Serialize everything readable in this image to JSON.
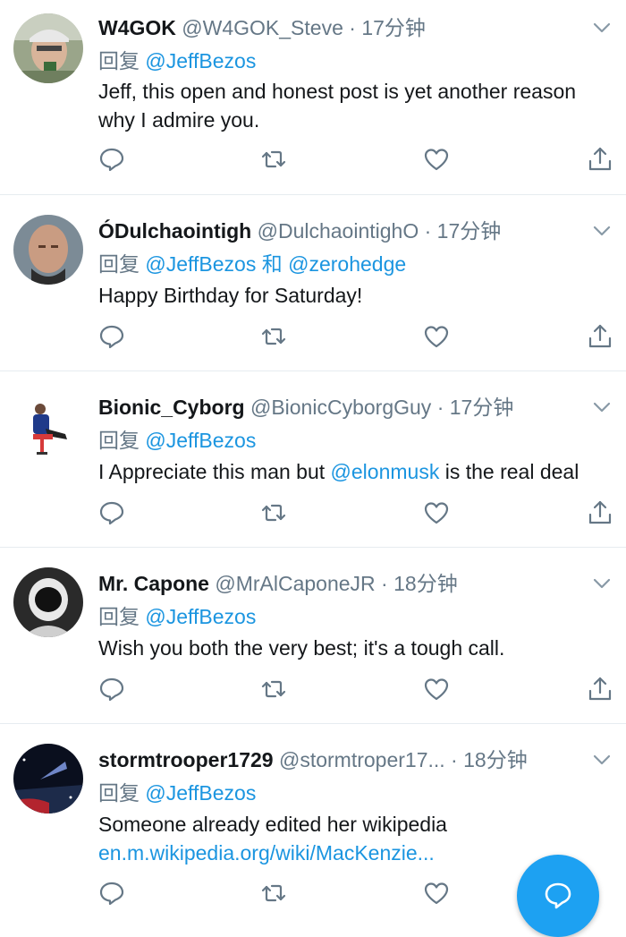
{
  "tweets": [
    {
      "name": "W4GOK",
      "handle": "@W4GOK_Steve",
      "separator": "·",
      "time": "17分钟",
      "reply_prefix": "回复",
      "reply_to": [
        "@JeffBezos"
      ],
      "reply_joiner": "",
      "text_plain": "Jeff, this open and honest post is yet another reason why I admire you.",
      "avatar_icon": "avatar-man-cap"
    },
    {
      "name": "ÓDulchaointigh",
      "handle": "@DulchaointighO",
      "separator": "·",
      "time": "17分钟",
      "reply_prefix": "回复",
      "reply_to": [
        "@JeffBezos",
        "@zerohedge"
      ],
      "reply_joiner": "和",
      "text_plain": "Happy Birthday for Saturday!",
      "avatar_icon": "avatar-bald-man"
    },
    {
      "name": "Bionic_Cyborg",
      "handle": "@BionicCyborgGuy",
      "separator": "·",
      "time": "17分钟",
      "reply_prefix": "回复",
      "reply_to": [
        "@JeffBezos"
      ],
      "reply_joiner": "",
      "text_before": "I Appreciate this man but ",
      "text_mention": "@elonmusk",
      "text_after": " is the real deal",
      "avatar_icon": "avatar-seated-figure"
    },
    {
      "name": "Mr. Capone",
      "handle": "@MrAlCaponeJR",
      "separator": "·",
      "time": "18分钟",
      "reply_prefix": "回复",
      "reply_to": [
        "@JeffBezos"
      ],
      "reply_joiner": "",
      "text_plain": "Wish you both the very best; it's a tough call.",
      "avatar_icon": "avatar-astronaut"
    },
    {
      "name": "stormtrooper1729",
      "handle": "@stormtroper17...",
      "separator": "·",
      "time": "18分钟",
      "reply_prefix": "回复",
      "reply_to": [
        "@JeffBezos"
      ],
      "reply_joiner": "",
      "text_plain": "Someone already edited her wikipedia",
      "text_link": "en.m.wikipedia.org/wiki/MacKenzie...",
      "avatar_icon": "avatar-space-scene"
    }
  ],
  "icons": {
    "reply": "reply-icon",
    "retweet": "retweet-icon",
    "like": "like-icon",
    "share": "share-icon",
    "more": "chevron-down-icon",
    "compose": "compose-icon"
  },
  "colors": {
    "link": "#1b95e0",
    "secondary": "#657786",
    "primary_text": "#14171a",
    "fab": "#1da1f2",
    "divider": "#e6ecf0"
  }
}
